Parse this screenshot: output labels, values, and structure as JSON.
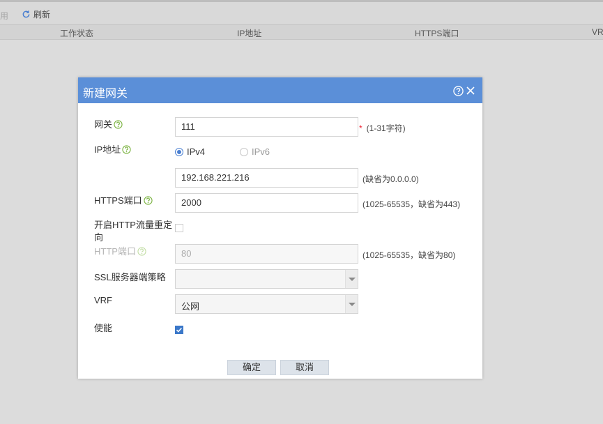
{
  "toolbar": {
    "disabled_label": "禁用",
    "refresh_label": "刷新"
  },
  "table": {
    "columns": [
      "工作状态",
      "IP地址",
      "HTTPS端口",
      "VRF"
    ]
  },
  "dialog": {
    "title": "新建网关",
    "gateway": {
      "label": "网关",
      "value": "111",
      "hint": "(1-31字符)"
    },
    "ip": {
      "label": "IP地址",
      "ipv4_label": "IPv4",
      "ipv6_label": "IPv6",
      "selected": "IPv4",
      "value": "192.168.221.216",
      "hint": "(缺省为0.0.0.0)"
    },
    "https_port": {
      "label": "HTTPS端口",
      "value": "2000",
      "hint": "(1025-65535，缺省为443)"
    },
    "http_redirect": {
      "label": "开启HTTP流量重定向",
      "checked": false
    },
    "http_port": {
      "label": "HTTP端口",
      "placeholder": "80",
      "hint": "(1025-65535，缺省为80)"
    },
    "ssl_policy": {
      "label": "SSL服务器端策略",
      "value": ""
    },
    "vrf": {
      "label": "VRF",
      "value": "公网"
    },
    "enable": {
      "label": "使能",
      "checked": true
    },
    "ok_label": "确定",
    "cancel_label": "取消"
  },
  "colors": {
    "header_blue": "#5b8fd8",
    "checkbox_blue": "#3b78c9",
    "required_red": "#e23"
  }
}
